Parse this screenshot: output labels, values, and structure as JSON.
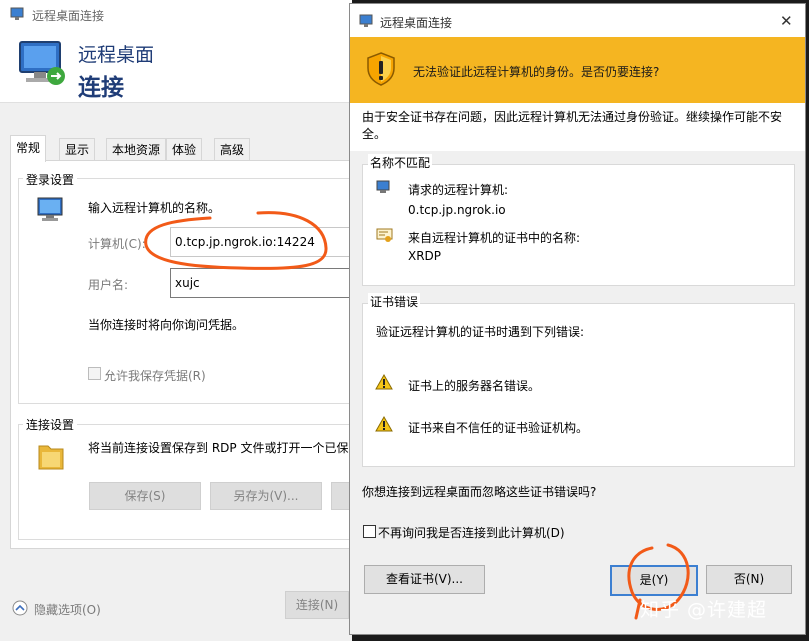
{
  "rdp_window": {
    "title": "远程桌面连接",
    "header_line1": "远程桌面",
    "header_line2": "连接",
    "tabs": [
      "常规",
      "显示",
      "本地资源",
      "体验",
      "高级"
    ],
    "login_group_title": "登录设置",
    "login_prompt": "输入远程计算机的名称。",
    "computer_label": "计算机(C):",
    "computer_value": "0.tcp.jp.ngrok.io:14224",
    "username_label": "用户名:",
    "username_value": "xujc",
    "credential_note": "当你连接时将向你询问凭据。",
    "save_credentials_label": "允许我保存凭据(R)",
    "connection_group_title": "连接设置",
    "connection_desc": "将当前连接设置保存到 RDP 文件或打开一个已保",
    "save_button": "保存(S)",
    "save_as_button": "另存为(V)...",
    "hide_options": "隐藏选项(O)",
    "connect_button": "连接(N)"
  },
  "dialog": {
    "title": "远程桌面连接",
    "banner_text": "无法验证此远程计算机的身份。是否仍要连接?",
    "description": "由于安全证书存在问题，因此远程计算机无法通过身份验证。继续操作可能不安全。",
    "name_mismatch_title": "名称不匹配",
    "requested_label": "请求的远程计算机:",
    "requested_value": "0.tcp.jp.ngrok.io",
    "cert_name_label": "来自远程计算机的证书中的名称:",
    "cert_name_value": "XRDP",
    "cert_errors_title": "证书错误",
    "cert_errors_intro": "验证远程计算机的证书时遇到下列错误:",
    "error1": "证书上的服务器名错误。",
    "error2": "证书来自不信任的证书验证机构。",
    "question": "你想连接到远程桌面而忽略这些证书错误吗?",
    "dont_ask_label": "不再询问我是否连接到此计算机(D)",
    "view_cert_button": "查看证书(V)...",
    "yes_button": "是(Y)",
    "no_button": "否(N)",
    "close_symbol": "✕"
  },
  "watermark": "知乎 @许建超",
  "colors": {
    "banner": "#f5b521",
    "annotation": "#f25a18"
  }
}
